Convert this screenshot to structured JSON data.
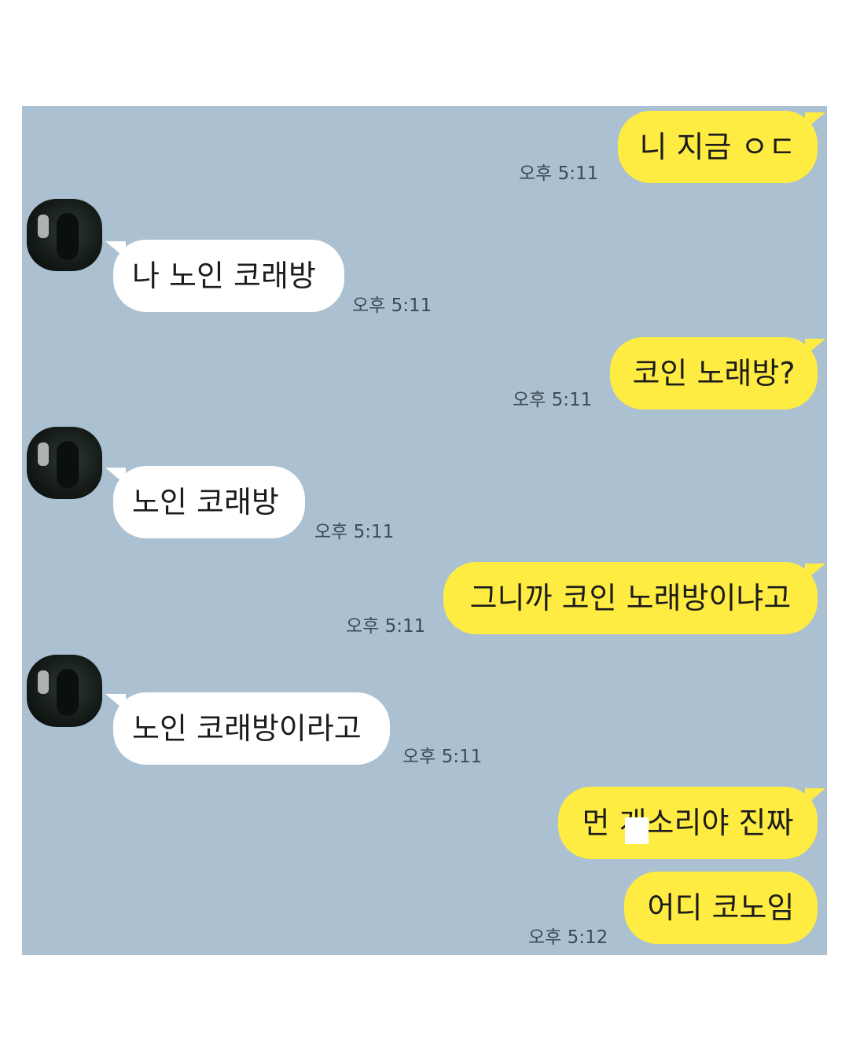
{
  "messages": [
    {
      "side": "me",
      "text": "니 지금 ㅇㄷ",
      "time": "오후 5:11"
    },
    {
      "side": "other",
      "text": "나 노인 코래방",
      "time": "오후 5:11"
    },
    {
      "side": "me",
      "text": "코인 노래방?",
      "time": "오후 5:11"
    },
    {
      "side": "other",
      "text": "노인 코래방",
      "time": "오후 5:11"
    },
    {
      "side": "me",
      "text": "그니까 코인 노래방이냐고",
      "time": "오후 5:11"
    },
    {
      "side": "other",
      "text": "노인 코래방이라고",
      "time": "오후 5:11"
    },
    {
      "side": "me",
      "text": "먼 개소리야 진짜",
      "time": ""
    },
    {
      "side": "me",
      "text": "어디 코노임",
      "time": "오후 5:12"
    }
  ],
  "colors": {
    "background": "#abc1d1",
    "my_bubble": "#ffec42",
    "their_bubble": "#ffffff"
  }
}
